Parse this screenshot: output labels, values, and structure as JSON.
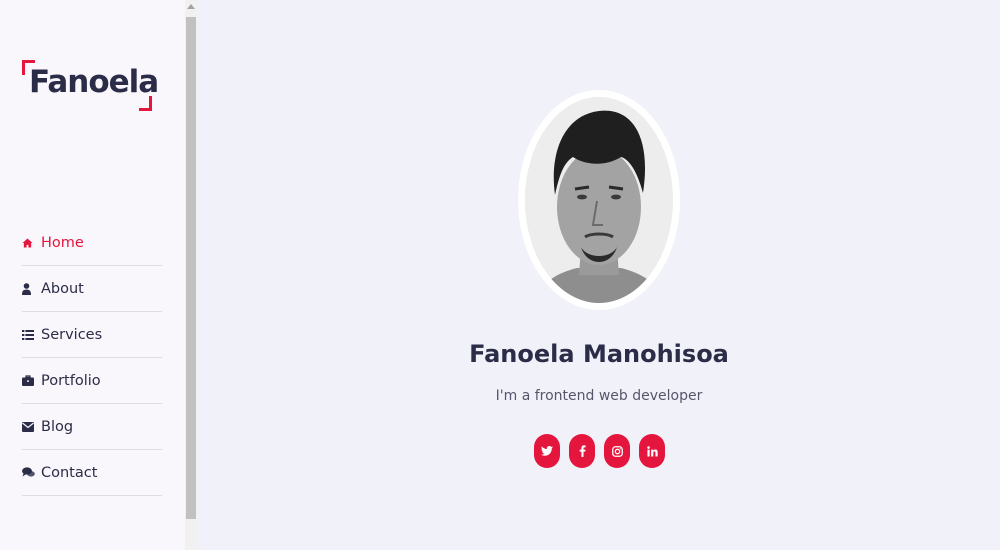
{
  "brand": {
    "logo_text": "Fanoela"
  },
  "nav": {
    "items": [
      {
        "label": "Home",
        "icon": "home-icon",
        "active": true
      },
      {
        "label": "About",
        "icon": "user-icon",
        "active": false
      },
      {
        "label": "Services",
        "icon": "list-icon",
        "active": false
      },
      {
        "label": "Portfolio",
        "icon": "briefcase-icon",
        "active": false
      },
      {
        "label": "Blog",
        "icon": "envelope-icon",
        "active": false
      },
      {
        "label": "Contact",
        "icon": "comments-icon",
        "active": false
      }
    ]
  },
  "profile": {
    "name": "Fanoela Manohisoa",
    "tagline": "I'm a frontend web developer"
  },
  "socials": [
    "twitter-icon",
    "facebook-icon",
    "instagram-icon",
    "linkedin-icon"
  ],
  "colors": {
    "accent": "#e5163e",
    "text": "#2b2c47",
    "page_bg": "#f1f1f9",
    "sidebar_bg": "#faf7fc"
  }
}
